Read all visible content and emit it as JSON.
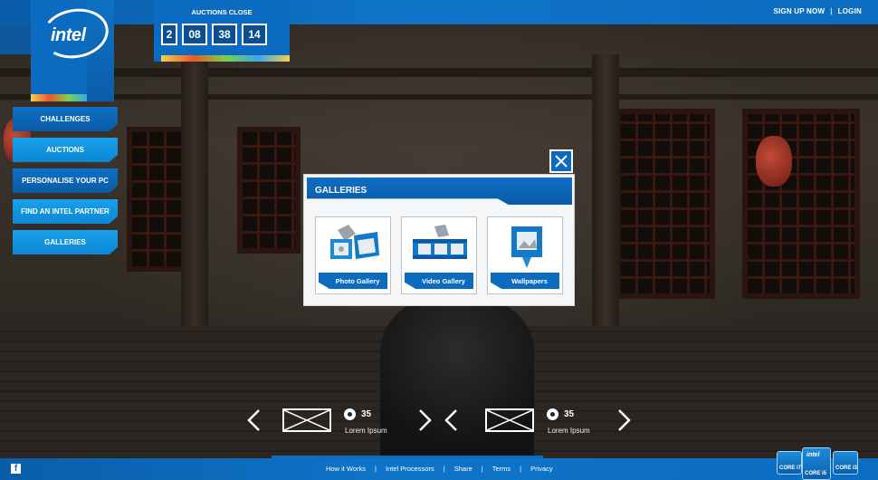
{
  "topbar": {
    "signup": "SIGN UP NOW",
    "separator": "|",
    "login": "LOGIN"
  },
  "logo": {
    "text": "intel"
  },
  "countdown": {
    "title": "AUCTIONS CLOSE",
    "digits": [
      "2",
      "08",
      "38",
      "14"
    ]
  },
  "nav": {
    "items": [
      {
        "label": "CHALLENGES"
      },
      {
        "label": "AUCTIONS"
      },
      {
        "label": "PERSONALISE YOUR PC"
      },
      {
        "label": "FIND AN INTEL PARTNER"
      },
      {
        "label": "GALLERIES"
      }
    ]
  },
  "modal": {
    "title": "GALLERIES",
    "tiles": [
      {
        "label": "Photo Gallery",
        "icon": "photo-gallery-icon"
      },
      {
        "label": "Video Gallery",
        "icon": "video-gallery-icon"
      },
      {
        "label": "Wallpapers",
        "icon": "wallpapers-icon"
      }
    ]
  },
  "carousel": {
    "items": [
      {
        "count": "35",
        "caption": "Lorem Ipsum"
      },
      {
        "count": "35",
        "caption": "Lorem Ipsum"
      }
    ]
  },
  "footer": {
    "links": [
      "How it Works",
      "Intel Processors",
      "Share",
      "Terms",
      "Privacy"
    ],
    "separator": "|",
    "fb": "f"
  },
  "badges": {
    "left": "CORE i7",
    "center": "CORE i5",
    "right": "CORE i3",
    "brand": "intel"
  },
  "colors": {
    "accent": "#0b6bc0",
    "accent_light": "#18a2ea"
  }
}
